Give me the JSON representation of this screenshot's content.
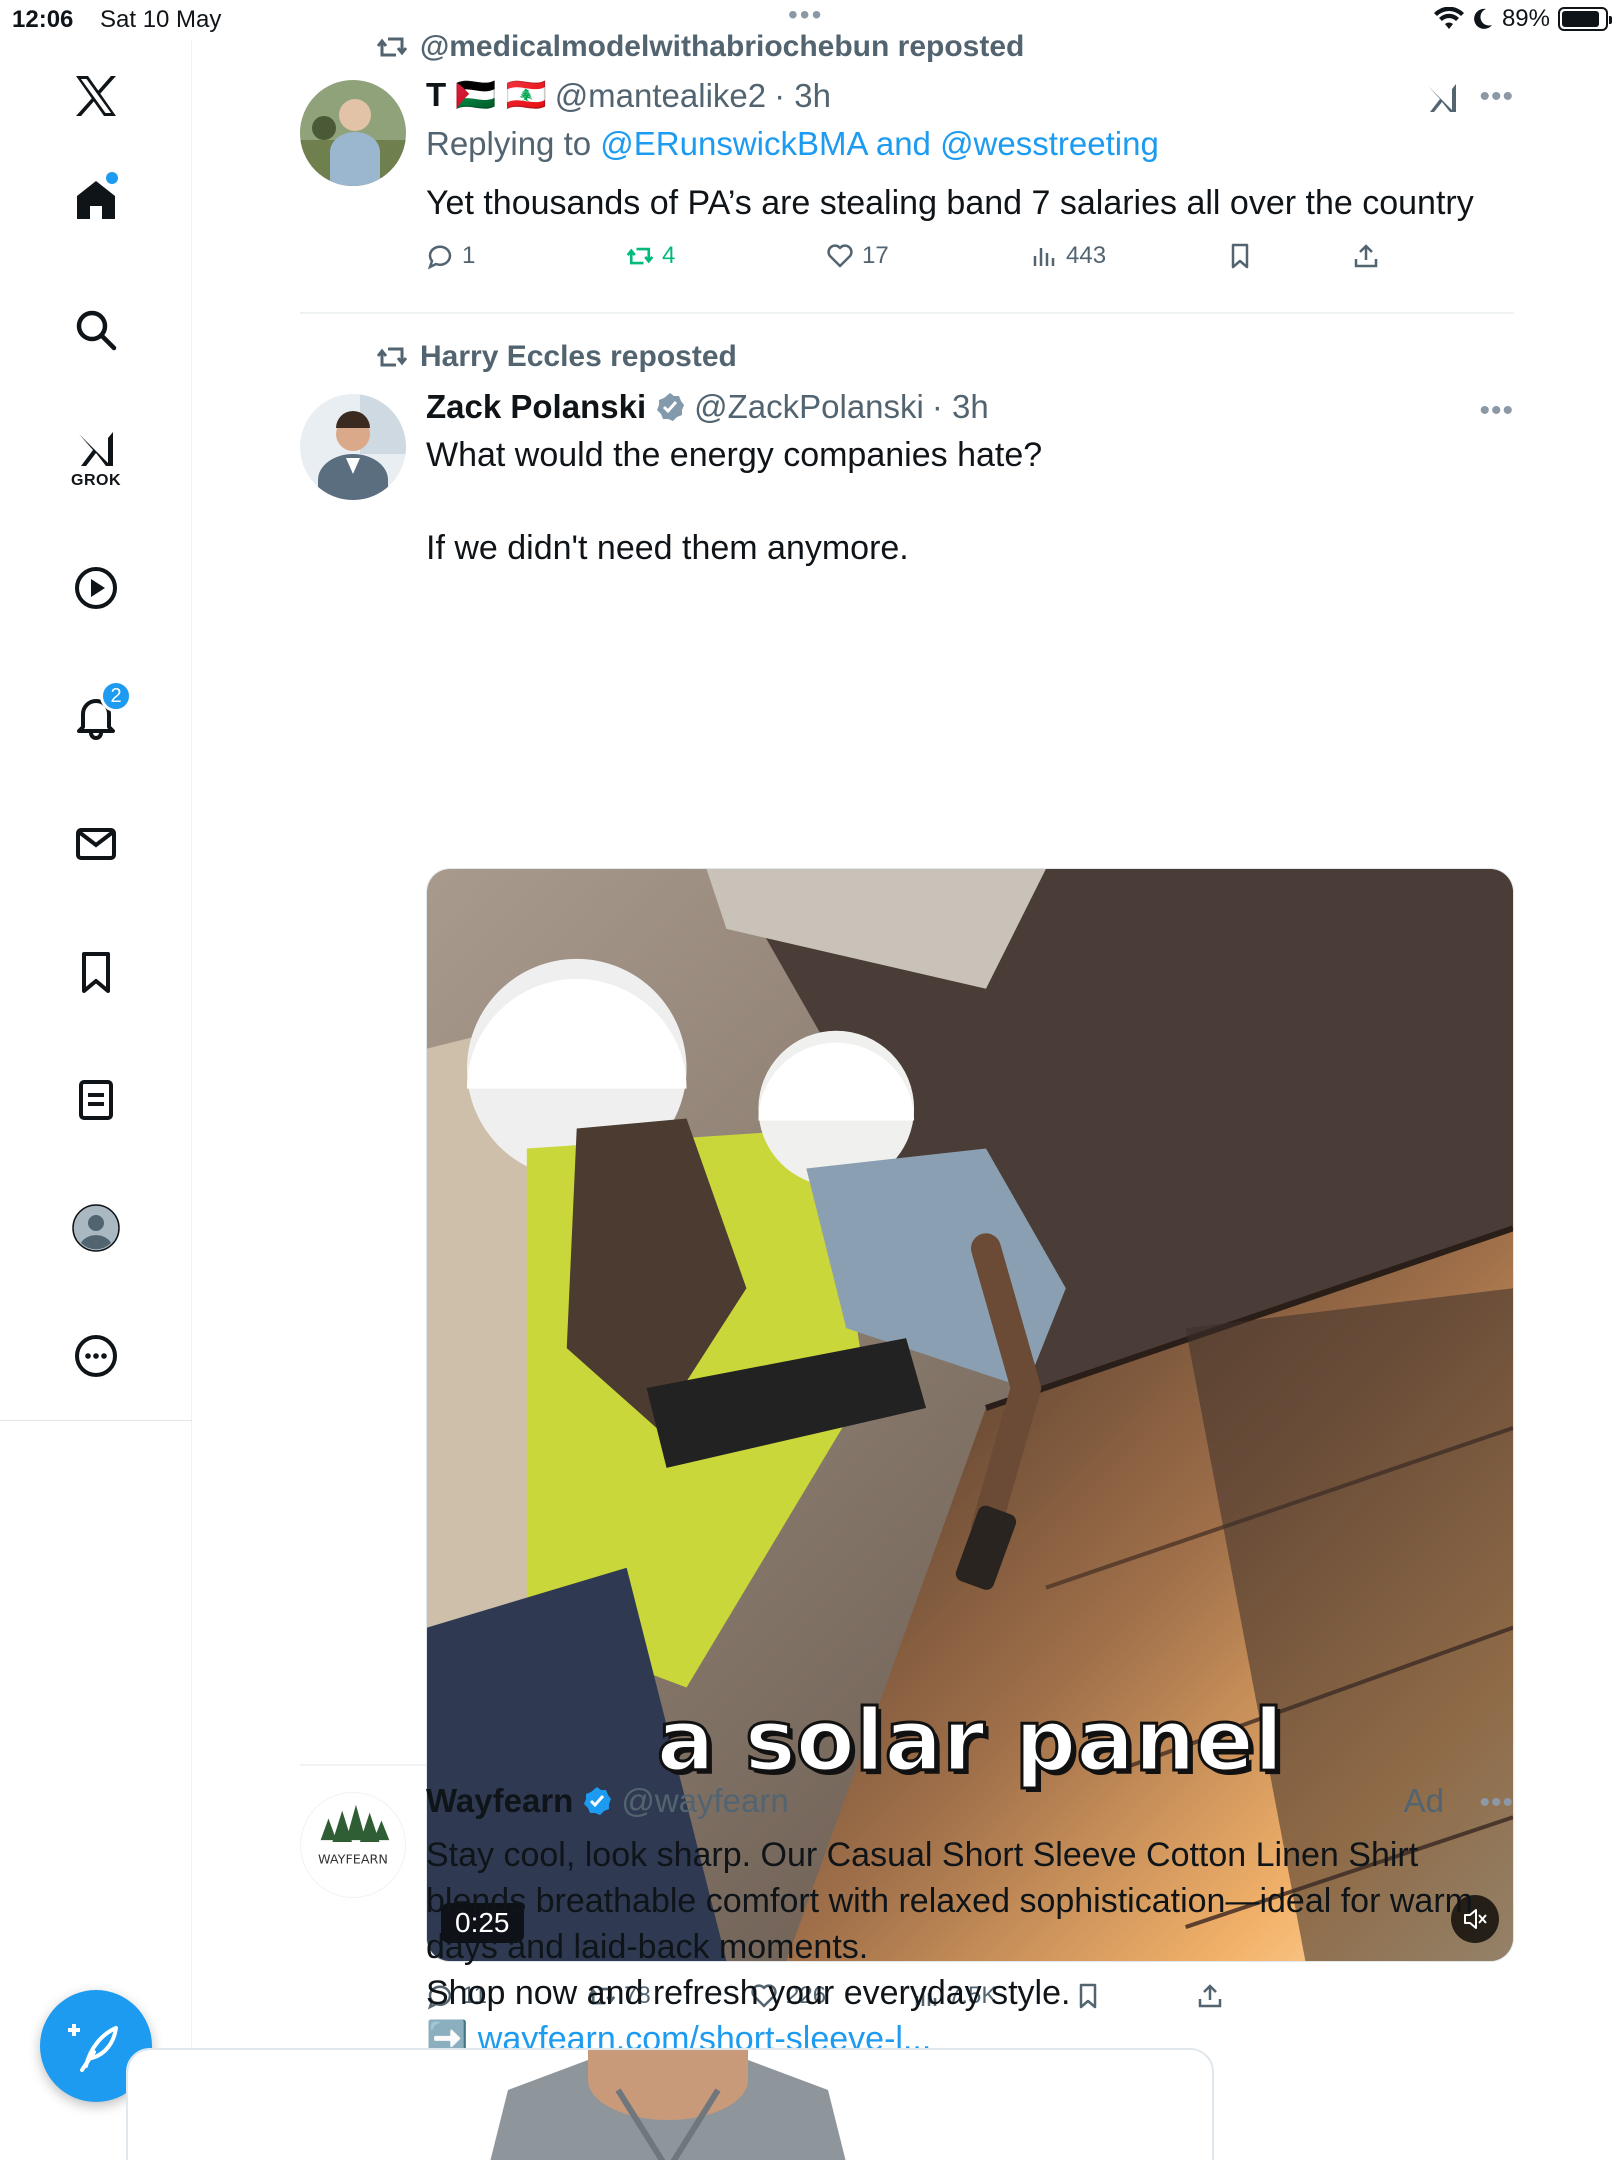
{
  "status_bar": {
    "time": "12:06",
    "date": "Sat 10 May",
    "battery": "89%",
    "battery_level": 0.89
  },
  "sidebar": {
    "items": [
      {
        "name": "x-logo",
        "label": ""
      },
      {
        "name": "home",
        "label": ""
      },
      {
        "name": "search",
        "label": ""
      },
      {
        "name": "grok",
        "label": "GROK"
      },
      {
        "name": "videos",
        "label": ""
      },
      {
        "name": "notifications",
        "label": "",
        "badge": "2"
      },
      {
        "name": "messages",
        "label": ""
      },
      {
        "name": "bookmarks",
        "label": ""
      },
      {
        "name": "lists",
        "label": ""
      },
      {
        "name": "profile",
        "label": ""
      },
      {
        "name": "more",
        "label": ""
      }
    ]
  },
  "tweets": [
    {
      "reposted_by": "@medicalmodelwithabriochebun reposted",
      "author": "T 🇵🇸 🇱🇧",
      "handle": "@mantealike2",
      "time": "· 3h",
      "replying_prefix": "Replying to ",
      "replying_to": "@ERunswickBMA and @wesstreeting",
      "text": "Yet thousands of PA’s are stealing band 7 salaries all over the country",
      "actions": {
        "replies": "1",
        "reposts": "4",
        "likes": "17",
        "views": "443"
      }
    },
    {
      "reposted_by": "Harry Eccles reposted",
      "author": "Zack Polanski",
      "handle": "@ZackPolanski",
      "time": "· 3h",
      "text_line1": "What would the energy companies hate?",
      "text_line2": "If we didn't need them anymore.",
      "media": {
        "caption": "a solar panel",
        "duration": "0:25"
      },
      "actions": {
        "replies": "11",
        "reposts": "78",
        "likes": "226",
        "views": "7.5K"
      }
    },
    {
      "author": "Wayfearn",
      "handle": "@wayfearn",
      "ad_label": "Ad",
      "avatar_text": "WAYFEARN",
      "text_lines": [
        "Stay cool, look sharp. Our Casual Short Sleeve Cotton Linen Shirt",
        "blends breathable comfort with relaxed sophistication—ideal for warm",
        "days and laid-back moments.",
        "Shop now and refresh your everyday style."
      ],
      "link_arrow": "➡️",
      "link": "wayfearn.com/short-sleeve-l..."
    }
  ],
  "colors": {
    "accent": "#1d9bf0",
    "repost_green": "#00ba7c",
    "secondary_text": "#536471"
  }
}
